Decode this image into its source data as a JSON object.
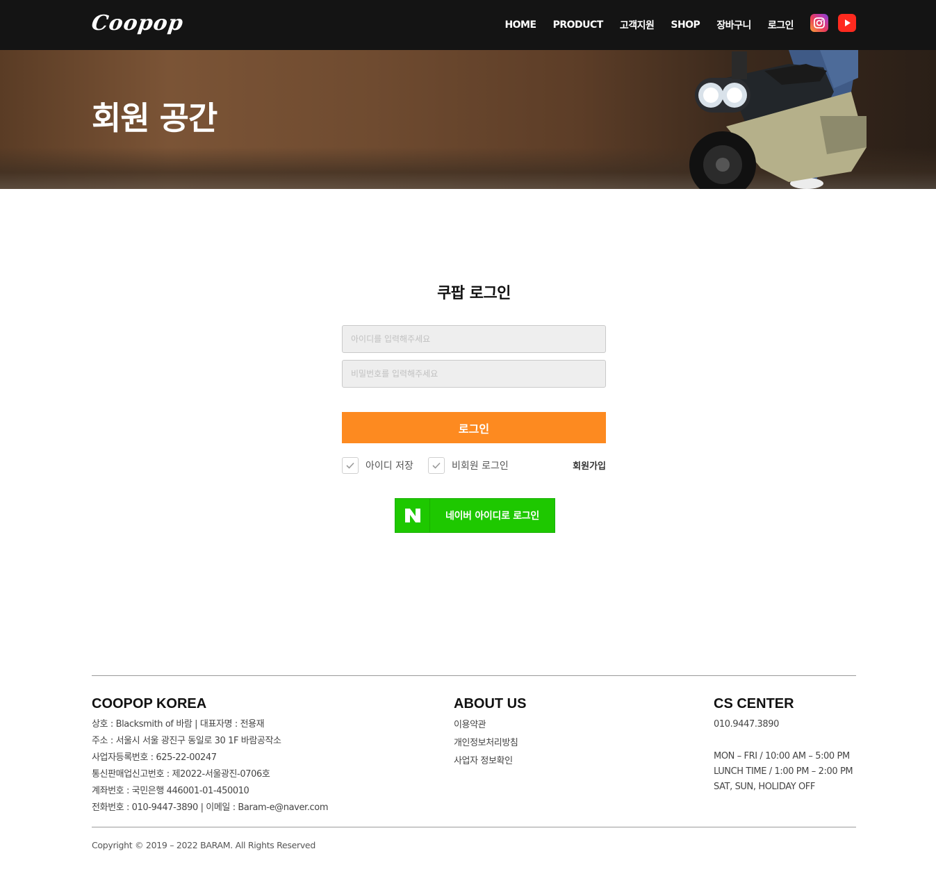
{
  "header": {
    "logo": "Coopop",
    "nav": [
      "HOME",
      "PRODUCT",
      "고객지원",
      "SHOP",
      "장바구니",
      "로그인"
    ],
    "social": {
      "instagram": "instagram-icon",
      "youtube": "youtube-icon"
    }
  },
  "hero": {
    "title": "회원 공간"
  },
  "login": {
    "title": "쿠팝 로그인",
    "id_placeholder": "아이디를 입력해주세요",
    "pw_placeholder": "비밀번호를 입력해주세요",
    "submit": "로그인",
    "save_id": "아이디 저장",
    "guest_login": "비회원 로그인",
    "signup": "회원가입",
    "naver": "네이버 아이디로 로그인"
  },
  "footer": {
    "company": {
      "title": "COOPOP KOREA",
      "lines": [
        "상호 : Blacksmith of 바람  |  대표자명 : 전용재",
        "주소 : 서울시 서울 광진구 동일로 30 1F 바람공작소",
        "사업자등록번호 : 625-22-00247",
        "통신판매업신고번호 : 제2022-서울광진-0706호",
        "계좌번호 : 국민은행 446001-01-450010",
        "전화번호 : 010-9447-3890  |  이메일 : Baram-e@naver.com"
      ]
    },
    "about": {
      "title": "ABOUT US",
      "links": [
        "이용약관",
        "개인정보처리방침",
        "사업자 정보확인"
      ]
    },
    "cs": {
      "title": "CS CENTER",
      "phone": "010.9447.3890",
      "hours": [
        "MON – FRI / 10:00 AM – 5:00 PM",
        "LUNCH TIME / 1:00 PM – 2:00 PM",
        "SAT, SUN, HOLIDAY OFF"
      ]
    },
    "copyright": "Copyright © 2019 – 2022 BARAM. All Rights Reserved"
  },
  "colors": {
    "header_bg": "#141414",
    "accent_orange": "#fd8a20",
    "naver_green": "#1ec800"
  }
}
